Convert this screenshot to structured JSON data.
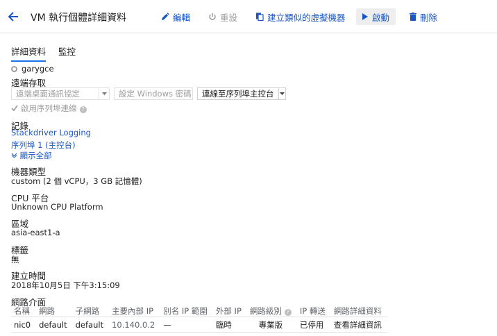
{
  "header": {
    "title": "VM 執行個體詳細資料",
    "edit_label": "編輯",
    "reset_label": "重設",
    "create_similar_label": "建立類似的虛擬機器",
    "start_label": "啟動",
    "delete_label": "刪除"
  },
  "tabs": [
    {
      "label": "詳細資料",
      "active": true
    },
    {
      "label": "監控",
      "active": false
    }
  ],
  "instance": {
    "name": "garygce"
  },
  "remote_access": {
    "label": "遠端存取",
    "rdp_select": "遠端桌面通訊協定",
    "windows_password": "設定 Windows 密碼",
    "serial_select": "連線至序列埠主控台",
    "serial_checkbox_label": "啟用序列埠連線",
    "serial_checked": true
  },
  "logs": {
    "label": "記錄",
    "stackdriver": "Stackdriver Logging",
    "serial_port": "序列埠 1 (主控台)",
    "show_all": "顯示全部"
  },
  "machine_type": {
    "label": "機器類型",
    "value": "custom (2 個 vCPU，3 GB 記憶體)"
  },
  "cpu_platform": {
    "label": "CPU 平台",
    "value": "Unknown CPU Platform"
  },
  "zone": {
    "label": "區域",
    "value": "asia-east1-a"
  },
  "labels": {
    "label": "標籤",
    "value": "無"
  },
  "created": {
    "label": "建立時間",
    "value": "2018年10月5日 下午3:15:09"
  },
  "network": {
    "label": "網路介面",
    "columns": [
      "名稱",
      "網路",
      "子網路",
      "主要內部 IP",
      "別名 IP 範圍",
      "外部 IP",
      "網路級別",
      "IP 轉送",
      "網路詳細資料"
    ],
    "rows": [
      [
        "nic0",
        "default",
        "default",
        "10.140.0.2",
        "—",
        "臨時",
        "專業版",
        "已停用",
        "查看詳細資訊"
      ]
    ]
  },
  "colors": {
    "accent": "#1a56c4",
    "muted": "#9e9e9e"
  }
}
